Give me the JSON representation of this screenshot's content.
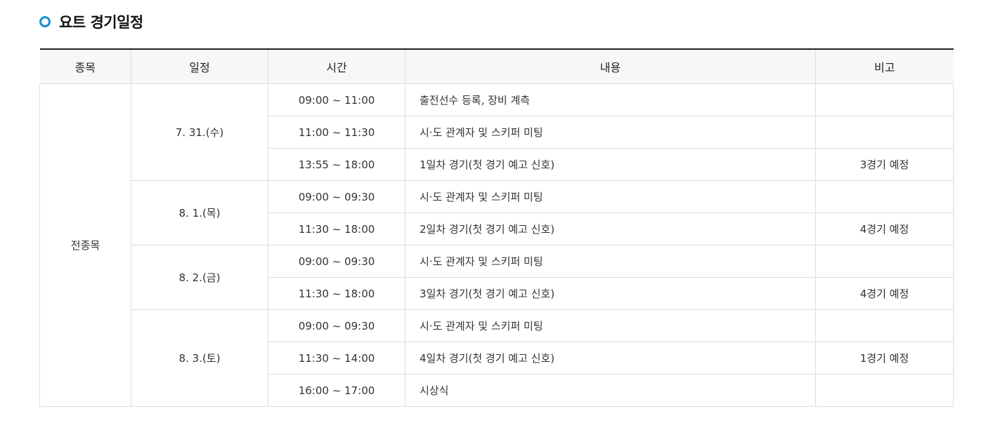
{
  "page_title": "요트 경기일정",
  "accent_color": "#1a8fd1",
  "table": {
    "headers": {
      "event": "종목",
      "date": "일정",
      "time": "시간",
      "content": "내용",
      "note": "비고"
    },
    "event": "전종목",
    "days": [
      {
        "date": "7. 31.(수)",
        "rows": [
          {
            "time": "09:00 ~ 11:00",
            "content": "출전선수 등록, 장비 계측",
            "note": ""
          },
          {
            "time": "11:00 ~ 11:30",
            "content": "시·도 관계자 및 스키퍼 미팅",
            "note": ""
          },
          {
            "time": "13:55 ~ 18:00",
            "content": "1일차 경기(첫 경기 예고 신호)",
            "note": "3경기 예정"
          }
        ]
      },
      {
        "date": "8. 1.(목)",
        "rows": [
          {
            "time": "09:00 ~ 09:30",
            "content": "시·도 관계자 및 스키퍼 미팅",
            "note": ""
          },
          {
            "time": "11:30 ~ 18:00",
            "content": "2일차 경기(첫 경기 예고 신호)",
            "note": "4경기 예정"
          }
        ]
      },
      {
        "date": "8. 2.(금)",
        "rows": [
          {
            "time": "09:00 ~ 09:30",
            "content": "시·도 관계자 및 스키퍼 미팅",
            "note": ""
          },
          {
            "time": "11:30 ~ 18:00",
            "content": "3일차 경기(첫 경기 예고 신호)",
            "note": "4경기 예정"
          }
        ]
      },
      {
        "date": "8. 3.(토)",
        "rows": [
          {
            "time": "09:00 ~ 09:30",
            "content": "시·도 관계자 및 스키퍼 미팅",
            "note": ""
          },
          {
            "time": "11:30 ~ 14:00",
            "content": "4일차 경기(첫 경기 예고 신호)",
            "note": "1경기 예정"
          },
          {
            "time": "16:00 ~ 17:00",
            "content": "시상식",
            "note": ""
          }
        ]
      }
    ]
  }
}
